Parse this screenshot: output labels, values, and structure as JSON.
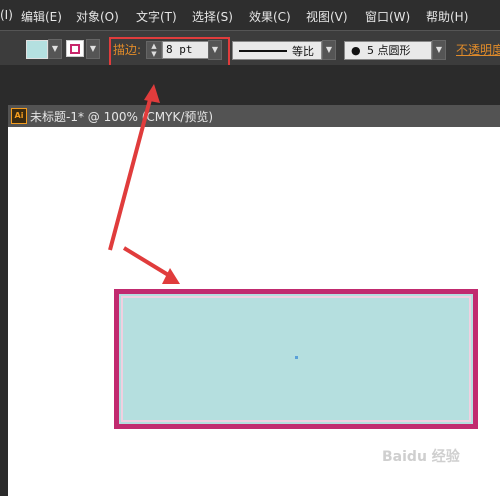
{
  "menubar": {
    "items": [
      {
        "label": "(I)"
      },
      {
        "label": "编辑(E)"
      },
      {
        "label": "对象(O)"
      },
      {
        "label": "文字(T)"
      },
      {
        "label": "选择(S)"
      },
      {
        "label": "效果(C)"
      },
      {
        "label": "视图(V)"
      },
      {
        "label": "窗口(W)"
      },
      {
        "label": "帮助(H)"
      }
    ]
  },
  "control_bar": {
    "fill_color": "#b4e0e0",
    "stroke_color": "#c8266a",
    "stroke_label": "描边:",
    "stroke_weight": "8 pt",
    "profile_label": "等比",
    "brush_label": "5 点圆形",
    "brush_dot": "●",
    "opacity_label": "不透明度"
  },
  "document": {
    "app_icon": "Ai",
    "tab_title": "未标题-1* @ 100% (CMYK/预览)"
  },
  "shape": {
    "fill_color": "#b5dfdf",
    "stroke_color": "#c12a6f"
  },
  "annotation": {
    "color": "#e03c3c"
  },
  "watermark": "Baidu 经验"
}
